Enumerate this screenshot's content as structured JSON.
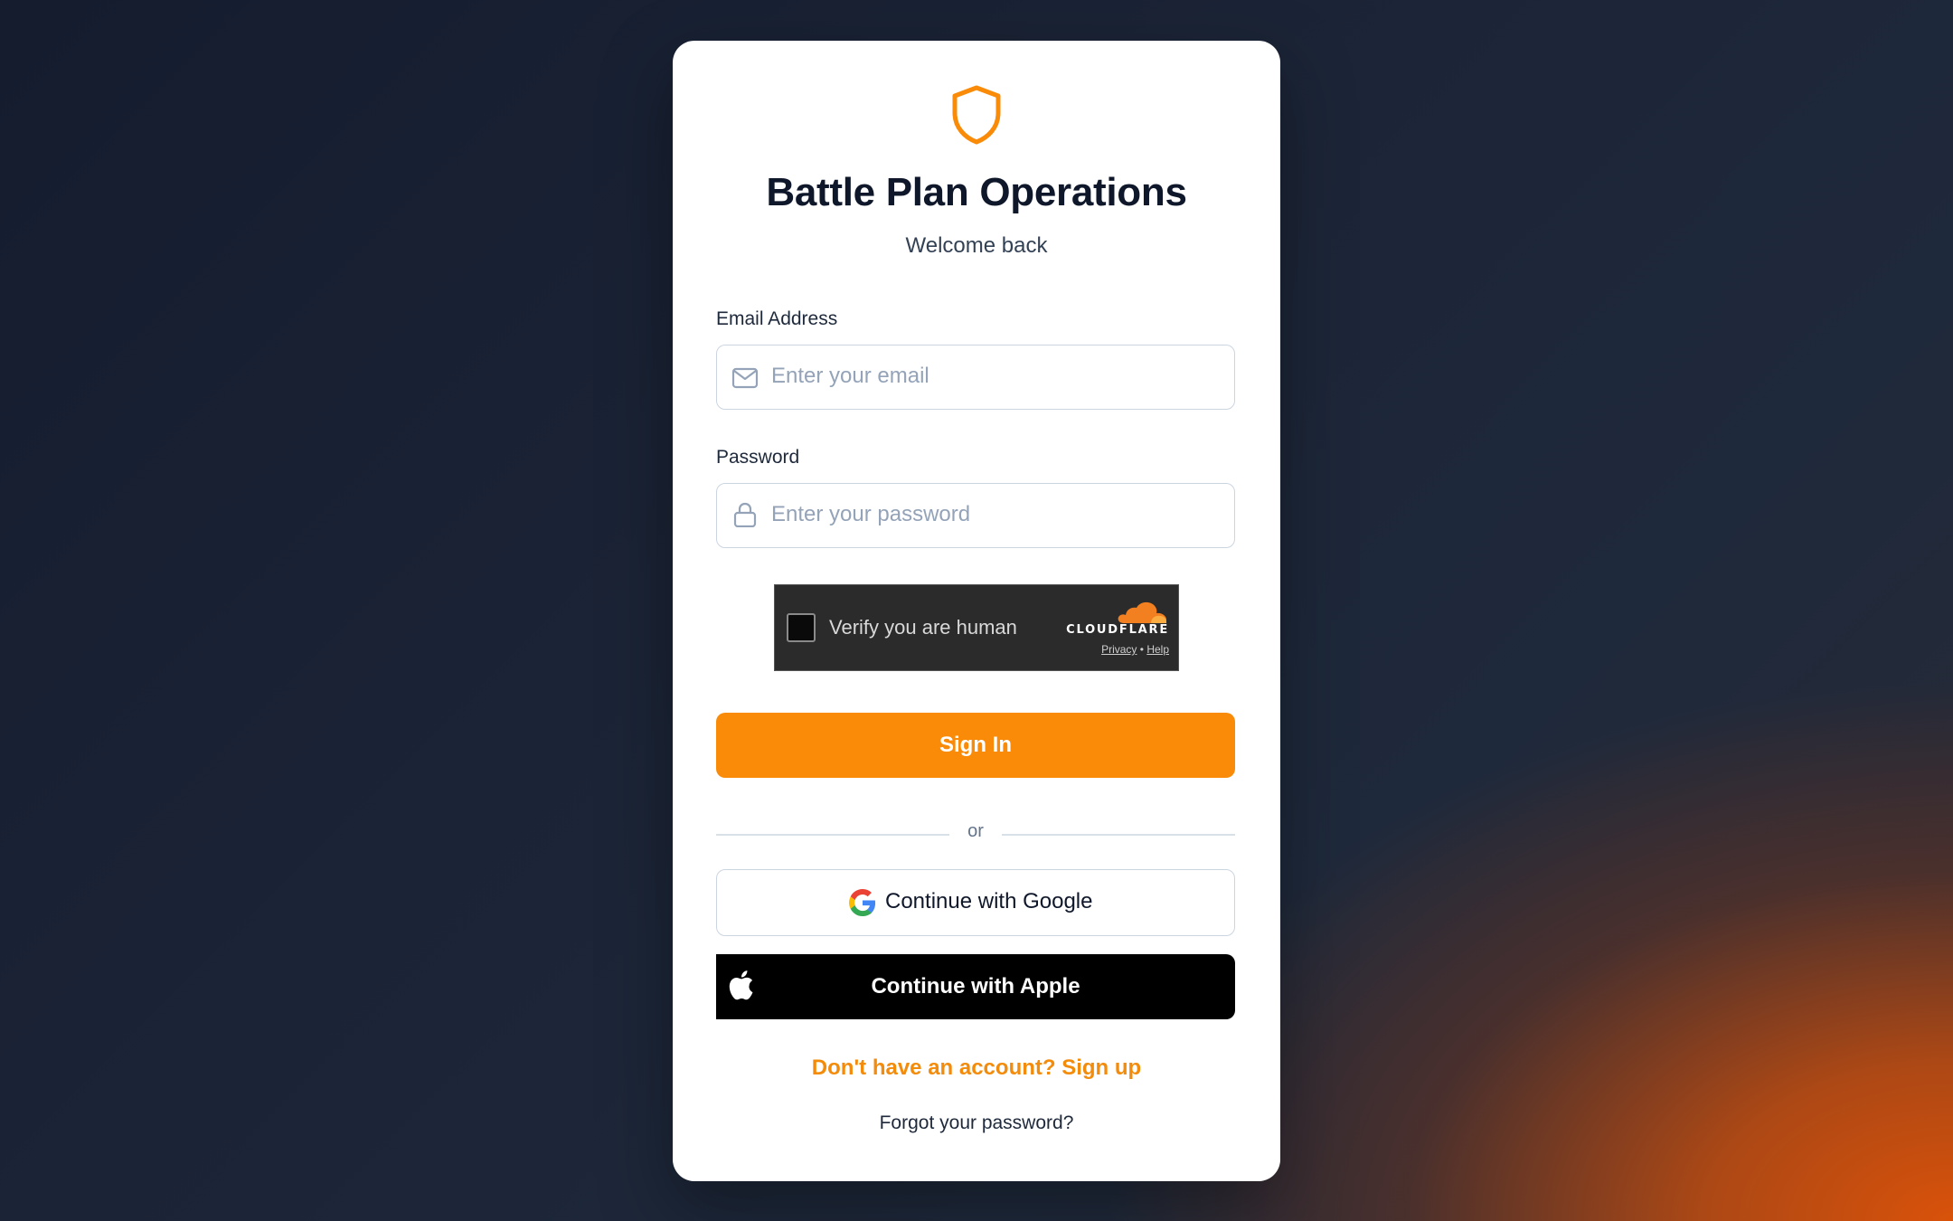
{
  "brand": {
    "title": "Battle Plan Operations",
    "subtitle": "Welcome back",
    "icon": "shield-icon",
    "accent_color": "#f98b08"
  },
  "form": {
    "email": {
      "label": "Email Address",
      "placeholder": "Enter your email",
      "value": "",
      "icon": "mail-icon"
    },
    "password": {
      "label": "Password",
      "placeholder": "Enter your password",
      "value": "",
      "icon": "lock-icon"
    },
    "captcha": {
      "text": "Verify you are human",
      "provider": "CLOUDFLARE",
      "privacy_link": "Privacy",
      "separator": "•",
      "help_link": "Help",
      "checked": false
    },
    "submit_label": "Sign In"
  },
  "divider_text": "or",
  "social": {
    "google_label": "Continue with Google",
    "apple_label": "Continue with Apple"
  },
  "links": {
    "signup": "Don't have an account? Sign up",
    "forgot": "Forgot your password?"
  }
}
